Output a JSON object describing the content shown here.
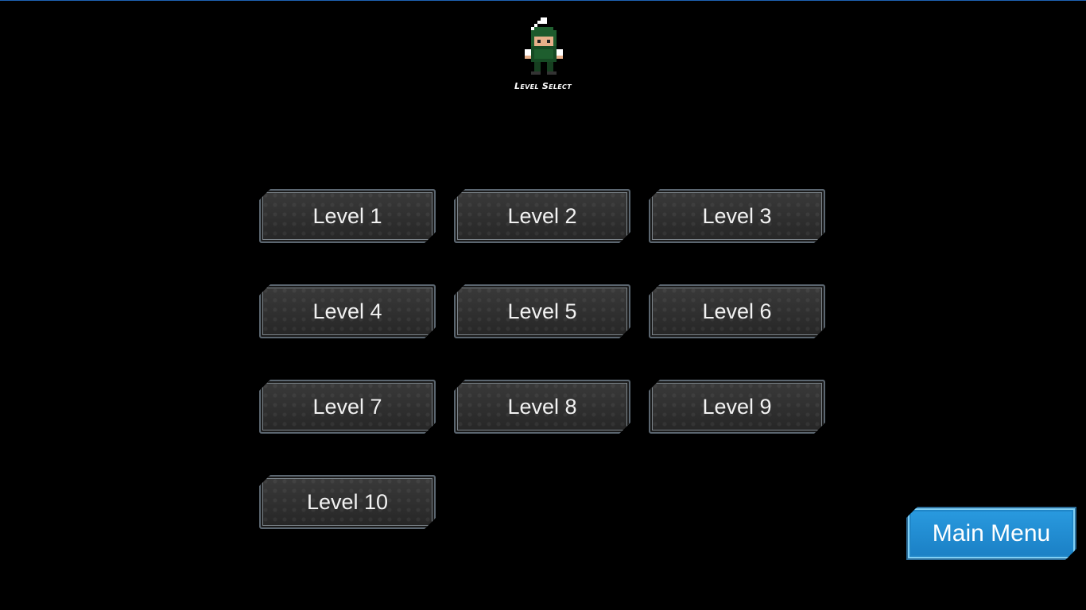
{
  "header": {
    "title": "Level Select",
    "character_icon": "pixel-soldier-icon"
  },
  "levels": [
    {
      "label": "Level 1"
    },
    {
      "label": "Level 2"
    },
    {
      "label": "Level 3"
    },
    {
      "label": "Level 4"
    },
    {
      "label": "Level 5"
    },
    {
      "label": "Level 6"
    },
    {
      "label": "Level 7"
    },
    {
      "label": "Level 8"
    },
    {
      "label": "Level 9"
    },
    {
      "label": "Level 10"
    }
  ],
  "main_menu": {
    "label": "Main Menu"
  },
  "colors": {
    "background": "#000000",
    "level_button": "#2c2c2c",
    "main_menu_button": "#1f8fd6",
    "top_edge": "#1e63b4"
  }
}
